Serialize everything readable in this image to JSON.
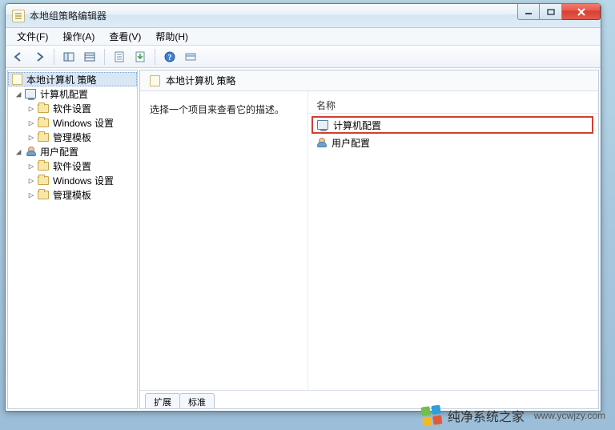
{
  "window": {
    "title": "本地组策略编辑器"
  },
  "menu": {
    "file": "文件(F)",
    "action": "操作(A)",
    "view": "查看(V)",
    "help": "帮助(H)"
  },
  "toolbar_icons": {
    "back": "back-icon",
    "forward": "forward-icon",
    "up": "up-icon",
    "show_hide": "show-hide-tree-icon",
    "export": "export-list-icon",
    "refresh": "refresh-icon",
    "help": "help-icon",
    "props": "properties-icon"
  },
  "tree": {
    "root": "本地计算机 策略",
    "computer": {
      "label": "计算机配置",
      "children": [
        "软件设置",
        "Windows 设置",
        "管理模板"
      ]
    },
    "user": {
      "label": "用户配置",
      "children": [
        "软件设置",
        "Windows 设置",
        "管理模板"
      ]
    }
  },
  "detail": {
    "header": "本地计算机 策略",
    "description": "选择一个项目来查看它的描述。",
    "col_name": "名称",
    "items": {
      "computer": "计算机配置",
      "user": "用户配置"
    }
  },
  "tabs": {
    "extended": "扩展",
    "standard": "标准"
  },
  "watermark": {
    "brand": "纯净系统之家",
    "url": "www.ycwjzy.com"
  }
}
